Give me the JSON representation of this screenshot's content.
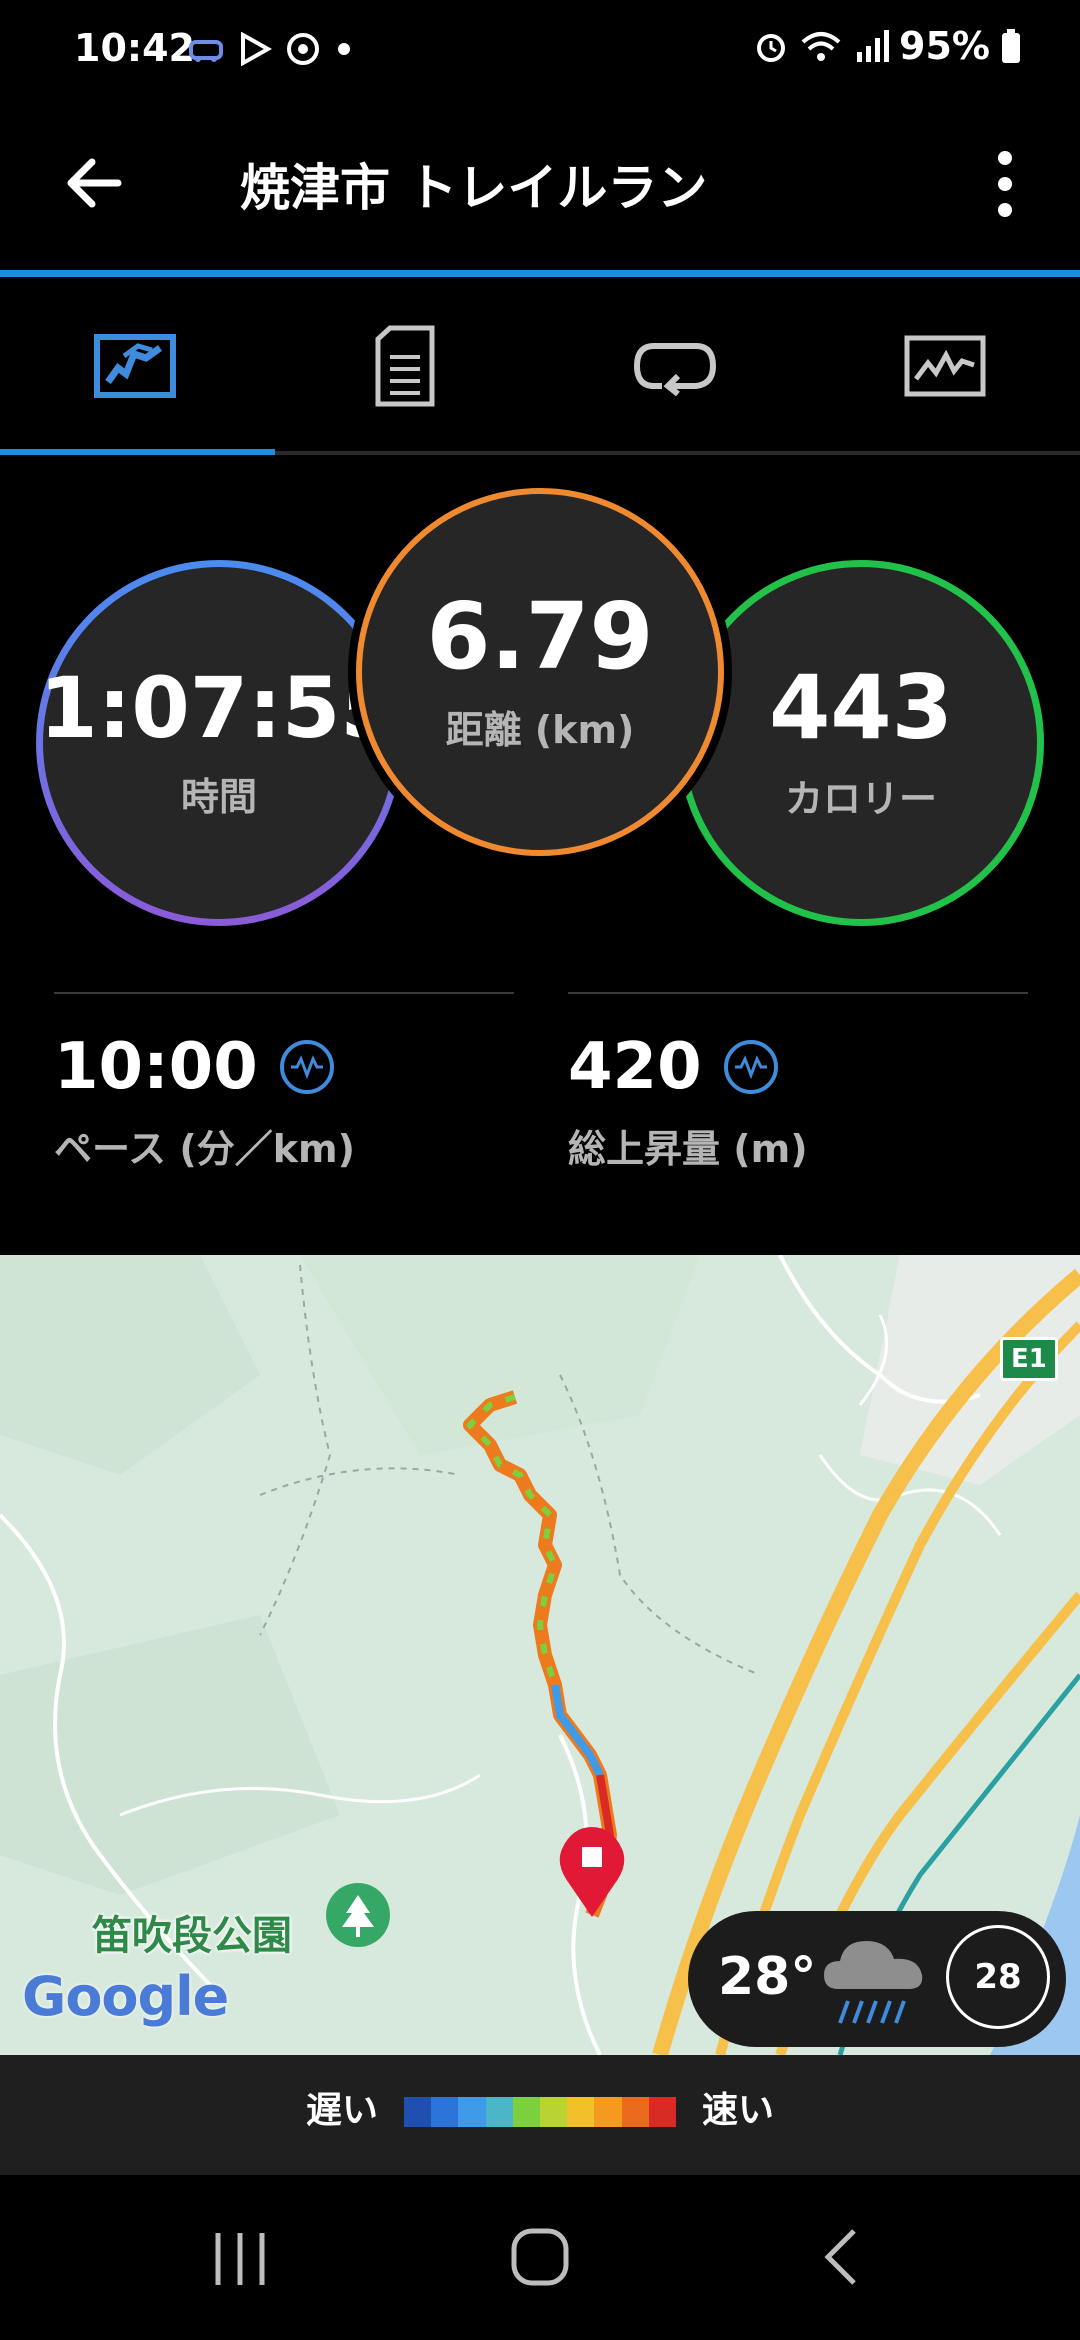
{
  "status_bar": {
    "time": "10:42",
    "battery": "95%"
  },
  "app_bar": {
    "title": "焼津市 トレイルラン"
  },
  "tabs": [
    {
      "icon": "map-icon",
      "active": true
    },
    {
      "icon": "details-document-icon",
      "active": false
    },
    {
      "icon": "laps-loop-icon",
      "active": false
    },
    {
      "icon": "chart-stats-icon",
      "active": false
    }
  ],
  "summary": {
    "time": {
      "value": "1:07:55",
      "label": "時間"
    },
    "distance": {
      "value": "6.79",
      "label": "距離 (km)"
    },
    "calories": {
      "value": "443",
      "label": "カロリー"
    }
  },
  "stats": {
    "pace": {
      "value": "10:00",
      "label": "ペース (分／km)"
    },
    "ascent": {
      "value": "420",
      "label": "総上昇量 (m)"
    }
  },
  "map": {
    "park_label": "笛吹段公園",
    "highway_label": "E1",
    "google_logo": "Google",
    "weather": {
      "temp": "28°",
      "badge": "28"
    }
  },
  "legend": {
    "slow": "遅い",
    "fast": "速い",
    "colors": [
      "#1f4fb0",
      "#2a73d9",
      "#3f9be8",
      "#4cb6c9",
      "#7ccf3d",
      "#b9d430",
      "#f2c129",
      "#f39a1f",
      "#ec6a1c",
      "#d92a24"
    ]
  },
  "colors": {
    "accent": "#1a8fe0",
    "time_ring": [
      "#4a8cf0",
      "#8c5ad8"
    ],
    "distance_ring": "#f08a30",
    "calories_ring": "#22c24a"
  }
}
